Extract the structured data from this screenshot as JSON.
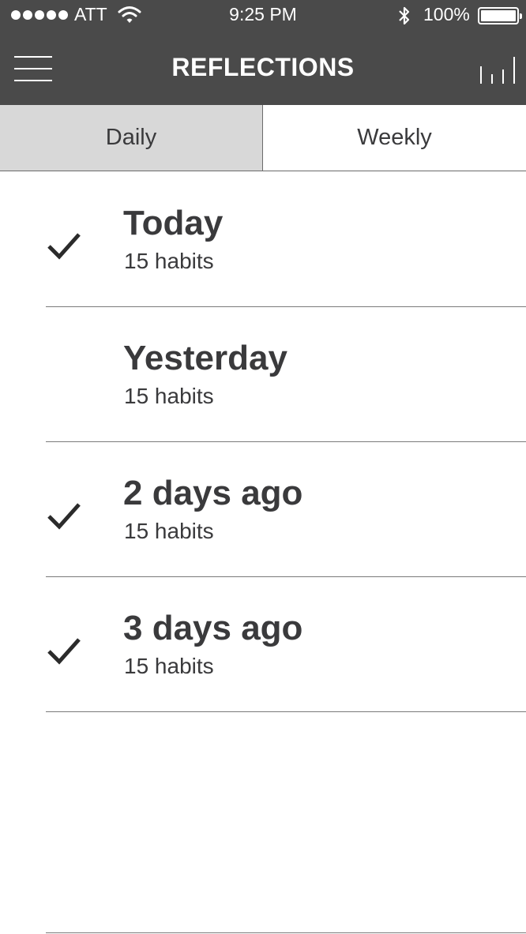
{
  "status_bar": {
    "carrier": "ATT",
    "time": "9:25 PM",
    "battery": "100%",
    "signal_bars": 5,
    "battery_level": 1.0
  },
  "header": {
    "title": "REFLECTIONS",
    "menu_icon": "hamburger-menu-icon",
    "stats_icon": "bar-chart-icon",
    "background_color": "#4a4a4a"
  },
  "tabs": [
    {
      "label": "Daily",
      "selected": true
    },
    {
      "label": "Weekly",
      "selected": false
    }
  ],
  "days": [
    {
      "title": "Today",
      "subtitle": "15 habits",
      "checked": true
    },
    {
      "title": "Yesterday",
      "subtitle": "15 habits",
      "checked": false
    },
    {
      "title": "2 days ago",
      "subtitle": "15 habits",
      "checked": true
    },
    {
      "title": "3 days ago",
      "subtitle": "15 habits",
      "checked": true
    }
  ]
}
